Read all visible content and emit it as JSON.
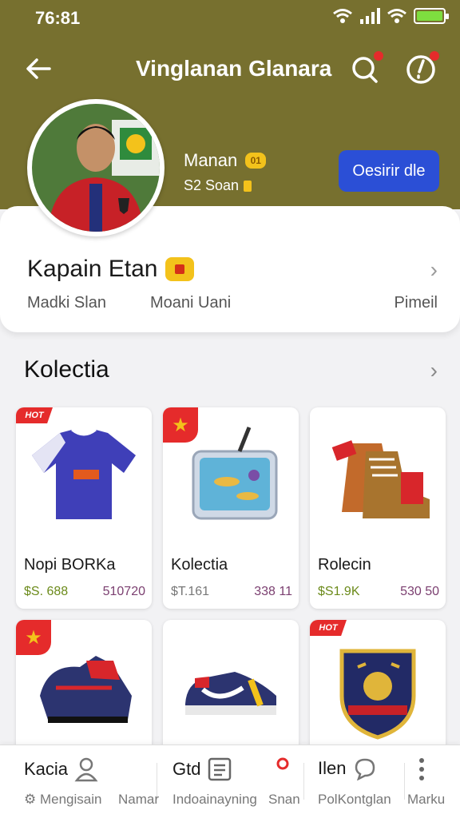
{
  "status": {
    "time": "76:81",
    "icons": [
      "wifi-icon",
      "signal-icon",
      "wifi-icon",
      "battery-icon"
    ],
    "battery_color": "#7ede3f"
  },
  "nav": {
    "title": "Vinglanan Glanara",
    "back_icon": "arrow-left-icon",
    "search_icon": "search-icon",
    "alert_icon": "alert-icon"
  },
  "profile": {
    "name": "Manan",
    "coin_label": "01",
    "sub": "S2 Soan",
    "button": "Oesirir dle"
  },
  "card": {
    "title": "Kapain Etan",
    "link1": "Madki Slan",
    "link2": "Moani Uani",
    "link3": "Pimeil"
  },
  "section": {
    "title": "Kolectia"
  },
  "products": [
    {
      "name": "Nopi BORKa",
      "price": "$S. 688",
      "alt_price": "510720",
      "tag": "HOT",
      "icon": "jersey-icon"
    },
    {
      "name": "Kolectia",
      "price": "$T.161",
      "alt_price": "338 11",
      "tag": "star",
      "icon": "collection-box-icon"
    },
    {
      "name": "Rolecin",
      "price": "$S1.9K",
      "alt_price": "530 50",
      "tag": "",
      "icon": "boots-icon"
    },
    {
      "name": "",
      "price": "",
      "alt_price": "",
      "tag": "star",
      "icon": "cleats-icon"
    },
    {
      "name": "",
      "price": "",
      "alt_price": "",
      "tag": "",
      "icon": "sneaker-icon"
    },
    {
      "name": "",
      "price": "",
      "alt_price": "",
      "tag": "HOT",
      "icon": "club-crest-icon"
    }
  ],
  "bottom_nav": {
    "item1": "Kacia",
    "item2": "Gtd",
    "item3": "Ilen",
    "sub1": "Mengisain",
    "sub2": "Namar",
    "sub3": "Indoainayning",
    "sub4": "Snan",
    "sub5": "PolKontglan",
    "sub6": "Marku"
  },
  "colors": {
    "header": "#77702f",
    "accent": "#2b4fd6",
    "hot_tag": "#e52b2b",
    "coin": "#f3c21b"
  }
}
